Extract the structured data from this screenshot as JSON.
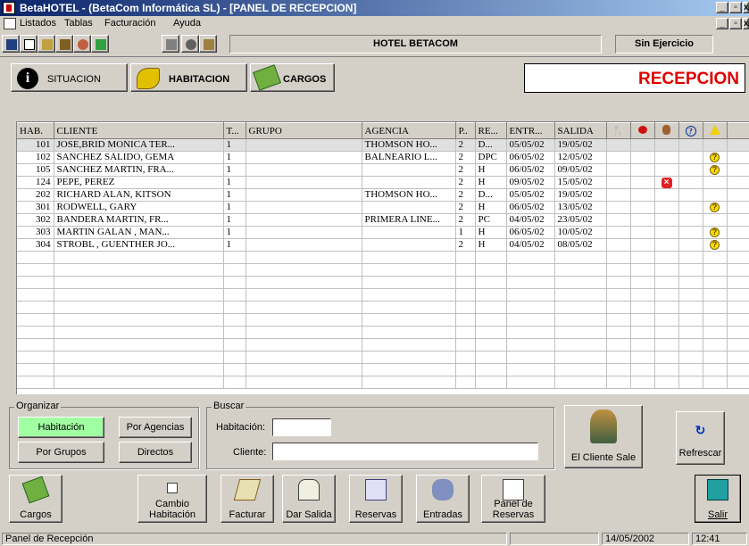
{
  "window": {
    "title": "BetaHOTEL - (BetaCom Informática SL) - [PANEL DE RECEPCION]"
  },
  "menu": [
    "Listados",
    "Tablas",
    "Facturación",
    "Ayuda"
  ],
  "toolbar": {
    "hotel": "HOTEL BETACOM",
    "ejercicio": "Sin Ejercicio"
  },
  "tabs": [
    {
      "label": "SITUACION"
    },
    {
      "label": "HABITACION"
    },
    {
      "label": "CARGOS"
    }
  ],
  "banner": "RECEPCION",
  "grid": {
    "columns": [
      "HAB.",
      "CLIENTE",
      "T...",
      "GRUPO",
      "AGENCIA",
      "P..",
      "RE...",
      "ENTR...",
      "SALIDA"
    ],
    "icons": [
      "cutlery-icon",
      "red-apple-icon",
      "person-icon",
      "question-icon",
      "warning-icon"
    ],
    "rows": [
      {
        "hab": "101",
        "cliente": "JOSE,BRID MONICA TER...",
        "t": "1",
        "grupo": "",
        "agencia": "THOMSON HO...",
        "p": "2",
        "re": "D...",
        "entr": "05/05/02",
        "salida": "19/05/02",
        "flag": ""
      },
      {
        "hab": "102",
        "cliente": "SANCHEZ SALIDO, GEMA",
        "t": "1",
        "grupo": "",
        "agencia": "BALNEARIO L...",
        "p": "2",
        "re": "DPC",
        "entr": "06/05/02",
        "salida": "12/05/02",
        "flag": "q"
      },
      {
        "hab": "105",
        "cliente": "SANCHEZ MARTIN, FRA...",
        "t": "1",
        "grupo": "",
        "agencia": "",
        "p": "2",
        "re": "H",
        "entr": "06/05/02",
        "salida": "09/05/02",
        "flag": "q"
      },
      {
        "hab": "124",
        "cliente": "PEPE, PEREZ",
        "t": "1",
        "grupo": "",
        "agencia": "",
        "p": "2",
        "re": "H",
        "entr": "09/05/02",
        "salida": "15/05/02",
        "flag": "x"
      },
      {
        "hab": "202",
        "cliente": "RICHARD ALAN, KITSON",
        "t": "1",
        "grupo": "",
        "agencia": "THOMSON HO...",
        "p": "2",
        "re": "D...",
        "entr": "05/05/02",
        "salida": "19/05/02",
        "flag": ""
      },
      {
        "hab": "301",
        "cliente": " RODWELL, GARY",
        "t": "1",
        "grupo": "",
        "agencia": "",
        "p": "2",
        "re": "H",
        "entr": "06/05/02",
        "salida": "13/05/02",
        "flag": "q"
      },
      {
        "hab": "302",
        "cliente": "BANDERA MARTIN, FR...",
        "t": "1",
        "grupo": "",
        "agencia": "PRIMERA LINE...",
        "p": "2",
        "re": "PC",
        "entr": "04/05/02",
        "salida": "23/05/02",
        "flag": ""
      },
      {
        "hab": "303",
        "cliente": "MARTIN GALAN , MAN...",
        "t": "1",
        "grupo": "",
        "agencia": "",
        "p": "1",
        "re": "H",
        "entr": "06/05/02",
        "salida": "10/05/02",
        "flag": "q"
      },
      {
        "hab": "304",
        "cliente": "STROBL , GUENTHER JO...",
        "t": "1",
        "grupo": "",
        "agencia": "",
        "p": "2",
        "re": "H",
        "entr": "04/05/02",
        "salida": "08/05/02",
        "flag": "q"
      }
    ]
  },
  "organizar": {
    "title": "Organizar",
    "habitacion": "Habitación",
    "agencias": "Por Agencias",
    "grupos": "Por Grupos",
    "directos": "Directos"
  },
  "buscar": {
    "title": "Buscar",
    "habitacion": "Habitación:",
    "cliente": "Cliente:"
  },
  "actions": {
    "cliente_sale": "El Cliente Sale",
    "refrescar": "Refrescar"
  },
  "bottom": {
    "cargos": "Cargos",
    "cambio1": "Cambio",
    "cambio2": "Habitación",
    "facturar": "Facturar",
    "dar_salida": "Dar Salida",
    "reservas": "Reservas",
    "entradas": "Entradas",
    "panel1": "Panel de",
    "panel2": "Reservas",
    "salir": "Salir"
  },
  "status": {
    "text": "Panel de Recepción",
    "date": "14/05/2002",
    "time": "12:41"
  }
}
